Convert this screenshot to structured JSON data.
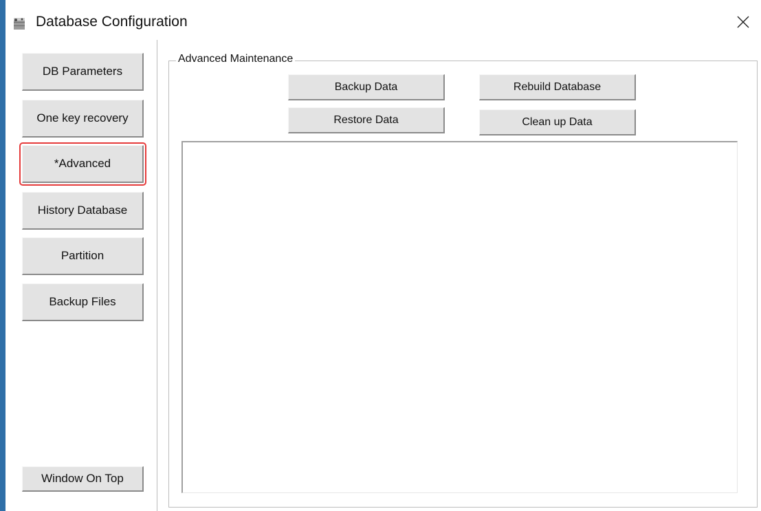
{
  "window": {
    "title": "Database Configuration",
    "icon": "database-icon",
    "close_icon": "close-icon"
  },
  "sidebar": {
    "items": [
      {
        "label": "DB Parameters",
        "highlighted": false
      },
      {
        "label": "One key recovery",
        "highlighted": false
      },
      {
        "label": "*Advanced",
        "highlighted": true
      },
      {
        "label": "History Database",
        "highlighted": false
      },
      {
        "label": "Partition",
        "highlighted": false
      },
      {
        "label": "Backup Files",
        "highlighted": false
      }
    ],
    "window_on_top_label": "Window On Top"
  },
  "main": {
    "group_title": "Advanced Maintenance",
    "buttons": {
      "backup_data": "Backup Data",
      "rebuild_database": "Rebuild Database",
      "restore_data": "Restore Data",
      "clean_up_data": "Clean up Data"
    },
    "output_text": ""
  },
  "colors": {
    "highlight": "#e53a3a",
    "button_face": "#e3e3e3"
  }
}
